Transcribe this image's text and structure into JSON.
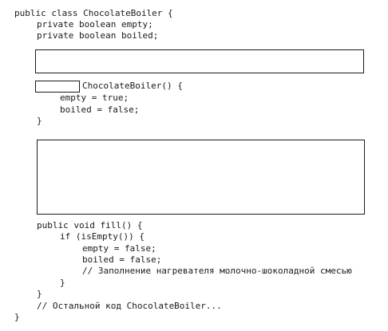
{
  "code": {
    "class_decl": "public class ChocolateBoiler {",
    "field_empty": "private boolean empty;",
    "field_boiled": "private boolean boiled;",
    "ctor_name": "ChocolateBoiler() {",
    "ctor_empty": "empty = true;",
    "ctor_boiled": "boiled = false;",
    "ctor_close": "}",
    "fill_decl": "public void fill() {",
    "fill_if": "if (isEmpty()) {",
    "fill_empty": "empty = false;",
    "fill_boiled": "boiled = false;",
    "fill_comment": "// Заполнение нагревателя молочно-шоколадной смесью",
    "if_close": "}",
    "fill_close": "}",
    "rest_comment": "// Остальной код ChocolateBoiler...",
    "class_close": "}"
  }
}
